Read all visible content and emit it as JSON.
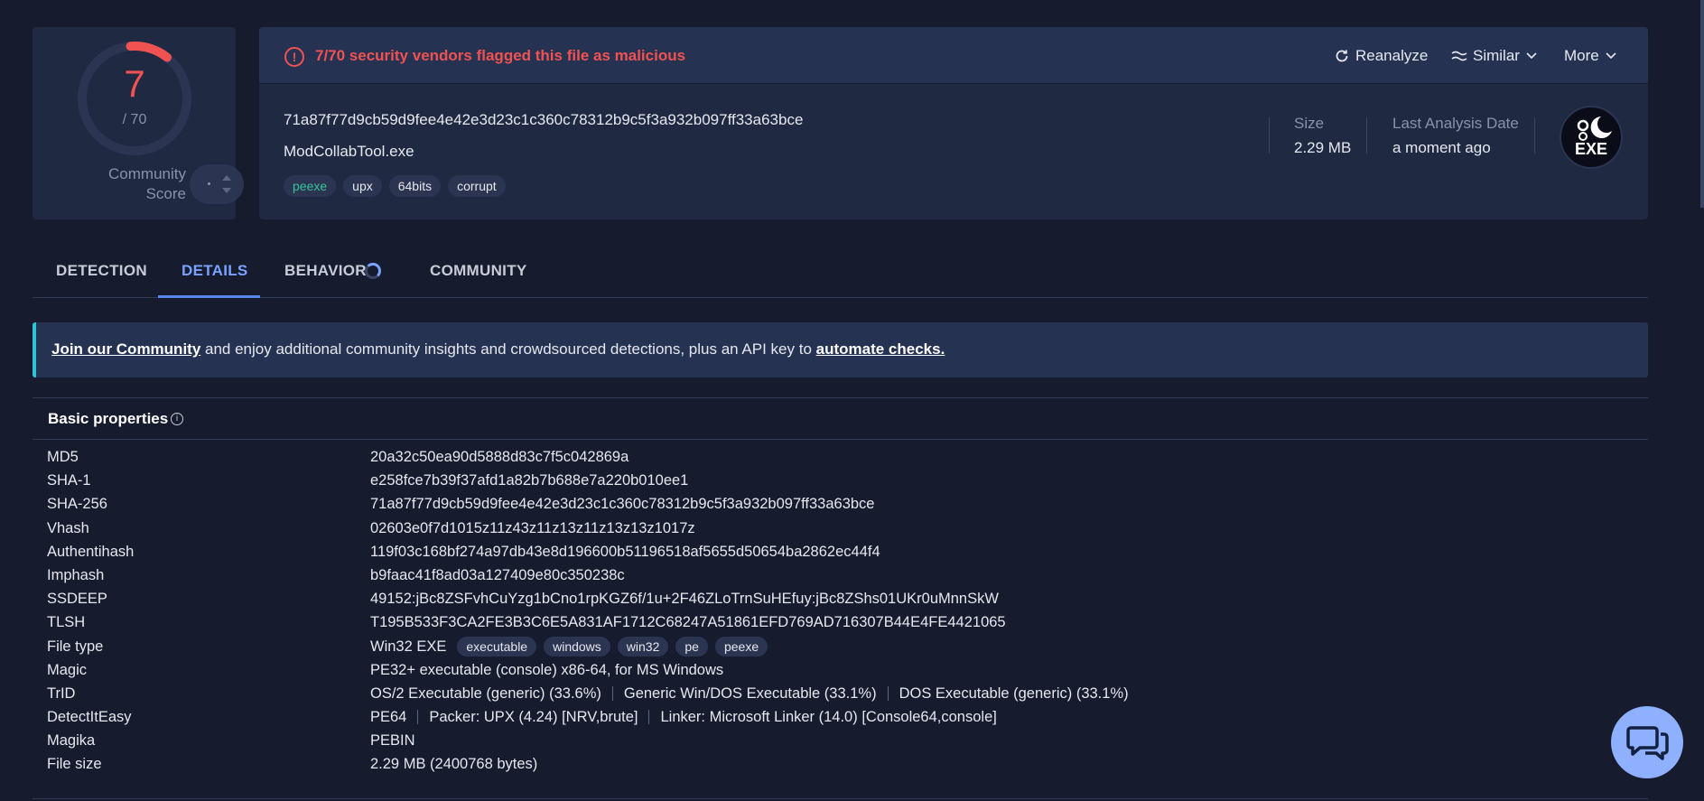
{
  "score": {
    "detections": "7",
    "total": "/ 70",
    "community_label": "Community Score",
    "accent_color": "#f05252"
  },
  "alert": {
    "text": "7/70 security vendors flagged this file as malicious",
    "icon": "alert-circle-icon"
  },
  "actions": {
    "reanalyze": "Reanalyze",
    "similar": "Similar",
    "more": "More"
  },
  "file": {
    "hash": "71a87f77d9cb59d9fee4e42e3d23c1c360c78312b9c5f3a932b097ff33a63bce",
    "name": "ModCollabTool.exe",
    "tags": [
      "peexe",
      "upx",
      "64bits",
      "corrupt"
    ],
    "size_label": "Size",
    "size_value": "2.29 MB",
    "last_analysis_label": "Last Analysis Date",
    "last_analysis_value": "a moment ago",
    "type_badge": "EXE"
  },
  "tabs": [
    "DETECTION",
    "DETAILS",
    "BEHAVIOR",
    "COMMUNITY"
  ],
  "active_tab": "DETAILS",
  "banner": {
    "link1": "Join our Community",
    "middle": " and enjoy additional community insights and crowdsourced detections, plus an API key to ",
    "link2": "automate checks."
  },
  "basic_properties": {
    "title": "Basic properties",
    "rows": {
      "md5": {
        "key": "MD5",
        "value": "20a32c50ea90d5888d83c7f5c042869a"
      },
      "sha1": {
        "key": "SHA-1",
        "value": "e258fce7b39f37afd1a82b7b688e7a220b010ee1"
      },
      "sha256": {
        "key": "SHA-256",
        "value": "71a87f77d9cb59d9fee4e42e3d23c1c360c78312b9c5f3a932b097ff33a63bce"
      },
      "vhash": {
        "key": "Vhash",
        "value": "02603e0f7d1015z11z43z11z13z11z13z13z1017z"
      },
      "authentihash": {
        "key": "Authentihash",
        "value": "119f03c168bf274a97db43e8d196600b51196518af5655d50654ba2862ec44f4"
      },
      "imphash": {
        "key": "Imphash",
        "value": "b9faac41f8ad03a127409e80c350238c"
      },
      "ssdeep": {
        "key": "SSDEEP",
        "value": "49152:jBc8ZSFvhCuYzg1bCno1rpKGZ6f/1u+2F46ZLoTrnSuHEfuy:jBc8ZShs01UKr0uMnnSkW"
      },
      "tlsh": {
        "key": "TLSH",
        "value": "T195B533F3CA2FE3B3C6E5A831AF1712C68247A51861EFD769AD716307B44E4FE4421065"
      },
      "file_type": {
        "key": "File type",
        "value": "Win32 EXE",
        "chips": [
          "executable",
          "windows",
          "win32",
          "pe",
          "peexe"
        ]
      },
      "magic": {
        "key": "Magic",
        "value": "PE32+ executable (console) x86-64, for MS Windows"
      },
      "trid": {
        "key": "TrID",
        "parts": [
          "OS/2 Executable (generic) (33.6%)",
          "Generic Win/DOS Executable (33.1%)",
          "DOS Executable (generic) (33.1%)"
        ]
      },
      "detectiteasy": {
        "key": "DetectItEasy",
        "parts": [
          "PE64",
          "Packer: UPX (4.24) [NRV,brute]",
          "Linker: Microsoft Linker (14.0) [Console64,console]"
        ]
      },
      "magika": {
        "key": "Magika",
        "value": "PEBIN"
      },
      "file_size": {
        "key": "File size",
        "value": "2.29 MB (2400768 bytes)"
      }
    }
  },
  "chat_icon": "chat-icon"
}
